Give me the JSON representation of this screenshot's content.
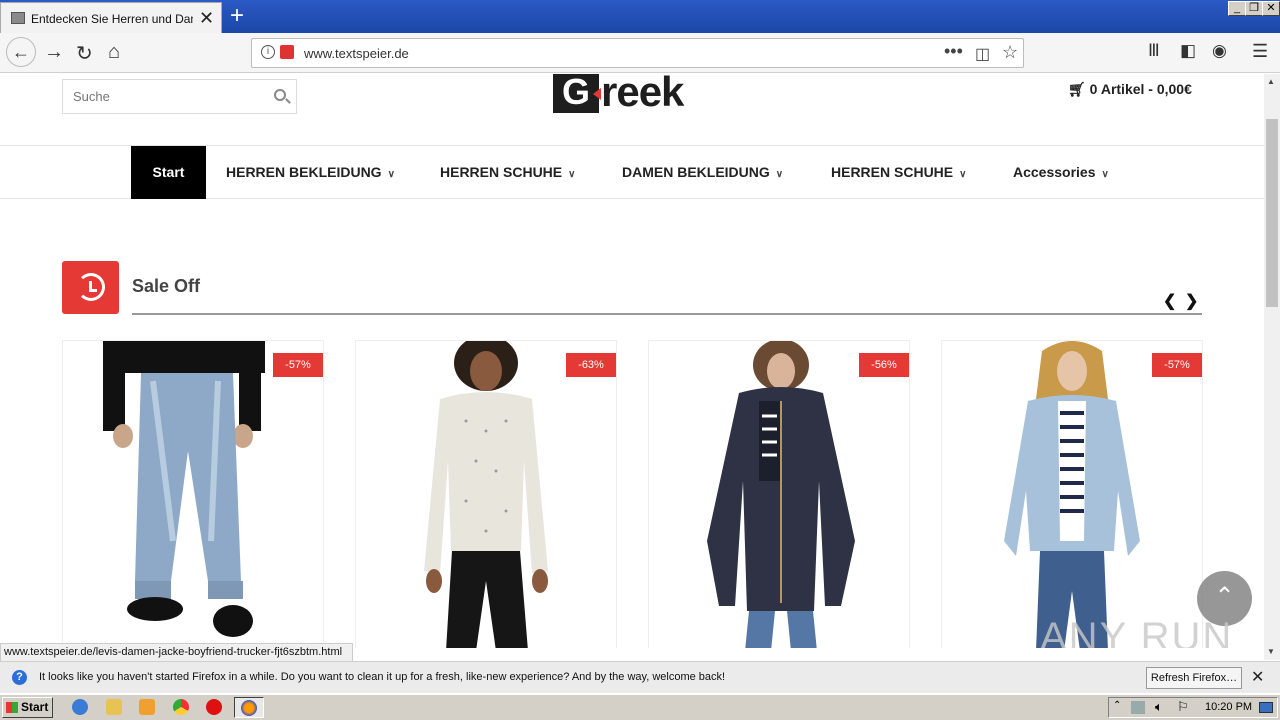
{
  "browser": {
    "tab_title": "Entdecken Sie Herren und Damen",
    "url": "www.textspeier.de",
    "status_url": "www.textspeier.de/levis-damen-jacke-boyfriend-trucker-fjt6szbtm.html"
  },
  "header": {
    "search_placeholder": "Suche",
    "logo_g": "G",
    "logo_rest": "reek",
    "cart": "0 Artikel - 0,00€"
  },
  "menu": {
    "start": "Start",
    "items": [
      "HERREN BEKLEIDUNG",
      "HERREN SCHUHE",
      "DAMEN BEKLEIDUNG",
      "HERREN SCHUHE",
      "Accessories"
    ]
  },
  "sale": {
    "title": "Sale Off",
    "products": [
      {
        "badge": "-57%"
      },
      {
        "badge": "-63%"
      },
      {
        "badge": "-56%"
      },
      {
        "badge": "-57%"
      }
    ]
  },
  "notification": {
    "message": "It looks like you haven't started Firefox in a while. Do you want to clean it up for a fresh, like-new experience? And by the way, welcome back!",
    "button": "Refresh Firefox…"
  },
  "taskbar": {
    "start": "Start",
    "time": "10:20 PM"
  },
  "watermark": "ANY RUN",
  "colors": {
    "accent": "#e53935",
    "titlebar": "#1c47a8"
  }
}
